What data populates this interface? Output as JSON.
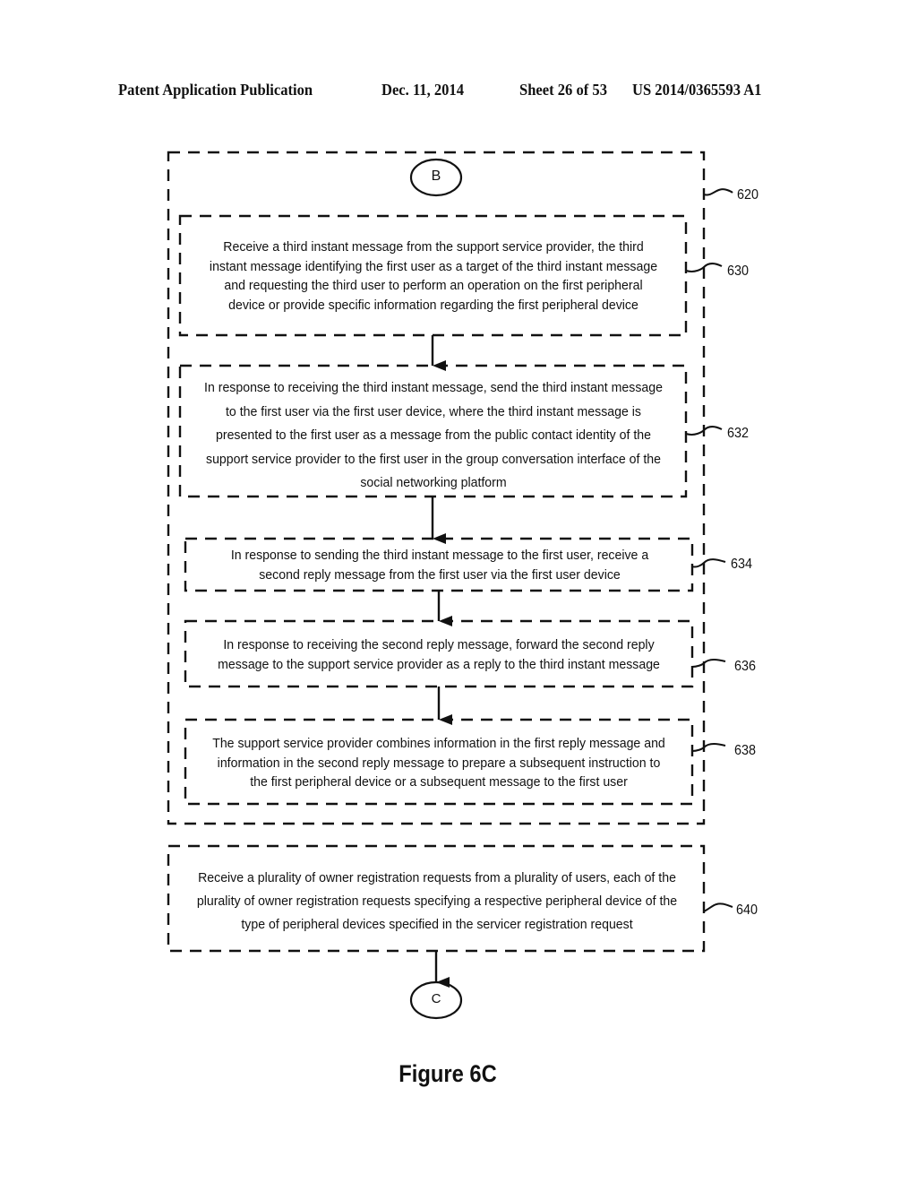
{
  "header": {
    "publication": "Patent Application Publication",
    "date": "Dec. 11, 2014",
    "sheet": "Sheet 26 of 53",
    "number": "US 2014/0365593 A1"
  },
  "connectors": {
    "start": "B",
    "end": "C"
  },
  "group": {
    "ref": "620"
  },
  "steps": [
    {
      "ref": "630",
      "text": "Receive a third instant message from the support service provider, the third instant message identifying the first user as a target of the third instant message and requesting the third user to perform an operation on the first peripheral device or provide specific information regarding the first peripheral device"
    },
    {
      "ref": "632",
      "text": "In response to receiving the third instant message, send the third instant message to the first user via the first user device, where the third instant message is presented to the first user as a message from the public contact identity of the support service provider to the first user in the group conversation interface of the social networking platform"
    },
    {
      "ref": "634",
      "text": "In response to sending the third instant message to the first user, receive a second reply message from the first user via the first user device"
    },
    {
      "ref": "636",
      "text": "In response to receiving the second reply message, forward the second reply message to the support service provider as a reply to the third instant message"
    },
    {
      "ref": "638",
      "text": "The support service provider combines information in the first reply message and information in the second reply message to prepare a subsequent instruction to the first peripheral device or a subsequent message to the first user"
    },
    {
      "ref": "640",
      "text": "Receive a plurality of owner registration requests from a plurality of users, each of the plurality of owner registration requests specifying a respective peripheral device of the type of peripheral devices specified in the servicer registration request"
    }
  ],
  "caption": "Figure 6C"
}
